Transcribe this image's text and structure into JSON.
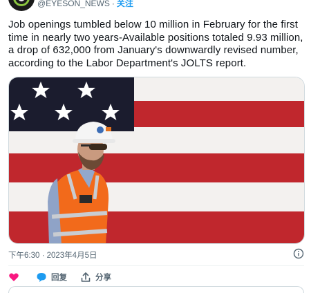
{
  "account": {
    "handle": "@EYESON_NEWS",
    "separator": "·",
    "follow_label": "关注",
    "avatar_icon": "eye-logo-icon"
  },
  "tweet": {
    "text": "Job openings tumbled below 10 million in February for the first time in nearly two years-Available positions totaled 9.93 million, a drop of 632,000 from January's downwardly revised number, according to the Labor Department's JOLTS report."
  },
  "media": {
    "description_icon": "photo-icon"
  },
  "meta": {
    "timestamp": "下午6:30 · 2023年4月5日",
    "info_icon": "info-icon"
  },
  "actions": {
    "like_icon": "heart-icon",
    "reply_icon": "reply-bubble-icon",
    "reply_label": "回复",
    "share_icon": "share-icon",
    "share_label": "分享"
  },
  "colors": {
    "accent": "#1d9bf0",
    "like": "#f91880",
    "secondary_text": "#536471",
    "flag_red": "#b22234",
    "flag_blue": "#1b1c2e"
  }
}
